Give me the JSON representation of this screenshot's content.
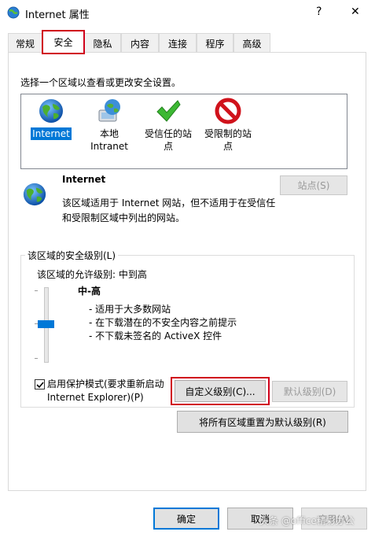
{
  "window": {
    "title": "Internet 属性",
    "help": "?",
    "close": "✕"
  },
  "tabs": [
    "常规",
    "安全",
    "隐私",
    "内容",
    "连接",
    "程序",
    "高级"
  ],
  "active_tab": 1,
  "security": {
    "instruction": "选择一个区域以查看或更改安全设置。",
    "zones": [
      {
        "label": "Internet",
        "icon": "globe-icon"
      },
      {
        "label": "本地\nIntranet",
        "icon": "intranet-globe-icon"
      },
      {
        "label": "受信任的站\n点",
        "icon": "check-icon"
      },
      {
        "label": "受限制的站\n点",
        "icon": "restricted-icon"
      }
    ],
    "selected_zone": "Internet",
    "zone_desc_title": "Internet",
    "zone_desc": "该区域适用于 Internet 网站，但不适用于在受信任和受限制区域中列出的网站。",
    "sites_button": "站点(S)",
    "level_group_title": "该区域的安全级别(L)",
    "allowed_levels": "该区域的允许级别: 中到高",
    "level_name": "中-高",
    "level_bullets": [
      "- 适用于大多数网站",
      "- 在下载潜在的不安全内容之前提示",
      "- 不下载未签名的 ActiveX 控件"
    ],
    "protected_mode_label": "启用保护模式(要求重新启动 Internet Explorer)(P)",
    "protected_mode_checked": true,
    "custom_level_button": "自定义级别(C)...",
    "default_level_button": "默认级别(D)",
    "reset_all_button": "将所有区域重置为默认级别(R)"
  },
  "footer": {
    "ok": "确定",
    "cancel": "取消",
    "apply": "应用(A)"
  },
  "watermark": "头条 @office精彩办公",
  "colors": {
    "highlight": "#d0021b",
    "selection": "#0078d7",
    "slider_thumb": "#0078d7",
    "primary_border": "#0078d7"
  }
}
